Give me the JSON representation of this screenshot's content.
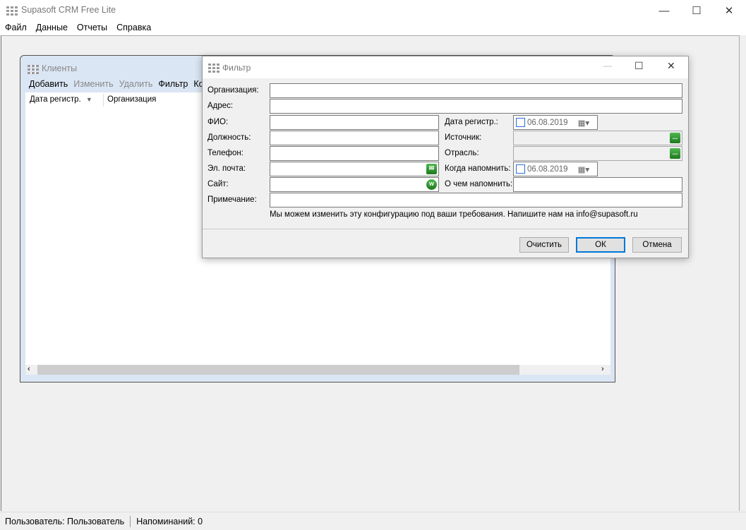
{
  "app": {
    "title": "Supasoft CRM Free Lite",
    "window_controls": {
      "minimize": "—",
      "maximize": "☐",
      "close": "✕"
    }
  },
  "menu": [
    "Файл",
    "Данные",
    "Отчеты",
    "Справка"
  ],
  "clients": {
    "title": "Клиенты",
    "toolbar": [
      {
        "label": "Добавить",
        "enabled": true
      },
      {
        "label": "Изменить",
        "enabled": false
      },
      {
        "label": "Удалить",
        "enabled": false
      },
      {
        "label": "Фильтр",
        "enabled": true
      },
      {
        "label": "Ко",
        "enabled": true
      }
    ],
    "columns": [
      "Дата регистр.",
      "Организация"
    ]
  },
  "filter": {
    "title": "Фильтр",
    "labels": {
      "org": "Организация:",
      "address": "Адрес:",
      "fio": "ФИО:",
      "position": "Должность:",
      "phone": "Телефон:",
      "email": "Эл. почта:",
      "site": "Сайт:",
      "note": "Примечание:",
      "reg_date": "Дата регистр.:",
      "source": "Источник:",
      "industry": "Отрасль:",
      "remind_when": "Когда напомнить:",
      "remind_what": "О чем напомнить:"
    },
    "reg_date": "06.08.2019",
    "remind_date": "06.08.2019",
    "info": "Мы можем изменить эту конфигурацию под ваши требования. Напишите нам на info@supasoft.ru",
    "buttons": {
      "clear": "Очистить",
      "ok": "ОК",
      "cancel": "Отмена"
    }
  },
  "status": {
    "user": "Пользователь: Пользователь",
    "reminders": "Напоминаний: 0"
  },
  "colors": {
    "accent": "#0078d7",
    "mdi_frame": "#dbe6f4",
    "green_button": "#2e8b2e"
  }
}
